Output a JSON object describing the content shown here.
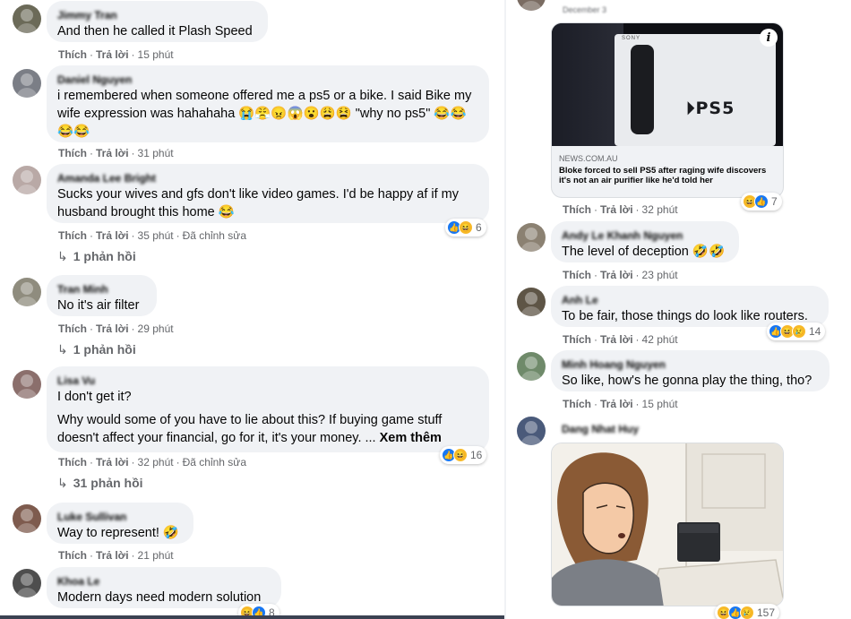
{
  "ui": {
    "like": "Thích",
    "reply": "Trả lời",
    "edited": "Đã chỉnh sửa"
  },
  "left_comments": [
    {
      "author": "Jimmy Tran",
      "text": "And then he called it Plash Speed",
      "time": "15 phút"
    },
    {
      "author": "Daniel Nguyen",
      "text": "i remembered when someone offered me a ps5 or a bike. I said Bike my wife expression was hahahaha 😭😤😠😱😮😩😫 \"why no ps5\" 😂😂😂😂",
      "time": "31 phút"
    },
    {
      "author": "Amanda Lee Bright",
      "text": "Sucks your wives and gfs don't like video games. I'd be happy af if my husband brought this home 😂",
      "time": "35 phút",
      "reactions": "6",
      "replies": "1 phản hồi"
    },
    {
      "author": "Tran Minh",
      "text": "No it's air filter",
      "time": "29 phút",
      "replies": "1 phản hồi"
    },
    {
      "author": "Lisa Vu",
      "text": "I don't get it?",
      "text2": "Why would some of you have to lie about this? If buying game stuff doesn't affect your financial, go for it, it's your money. ...",
      "see_more": "Xem thêm",
      "time": "32 phút",
      "reactions": "16",
      "replies": "31 phản hồi"
    },
    {
      "author": "Luke Sullivan",
      "text": "Way to represent! 🤣",
      "time": "21 phút"
    },
    {
      "author": "Khoa Le",
      "text": "Modern days need modern solution",
      "reactions": "8"
    }
  ],
  "right_top": {
    "meta": "December 3",
    "card_source": "NEWS.COM.AU",
    "card_title": "Bloke forced to sell PS5 after raging wife discovers it's not an air purifier like he'd told her",
    "time": "32 phút",
    "reactions": "7"
  },
  "right_comments": [
    {
      "author": "Andy Le Khanh Nguyen",
      "text": "The level of deception 🤣🤣",
      "time": "23 phút"
    },
    {
      "author": "Anh Le",
      "text": "To be fair, those things do look like routers.",
      "time": "42 phút",
      "reactions": "14"
    },
    {
      "author": "Minh Hoang Nguyen",
      "text": "So like, how's he gonna play the thing, tho?",
      "time": "15 phút"
    },
    {
      "author": "Dang Nhat Huy",
      "reactions": "157"
    }
  ],
  "colors": {
    "bubble": "#f0f2f5",
    "meta": "#65676b",
    "like": "#1877f2",
    "haha": "#f7b928"
  }
}
